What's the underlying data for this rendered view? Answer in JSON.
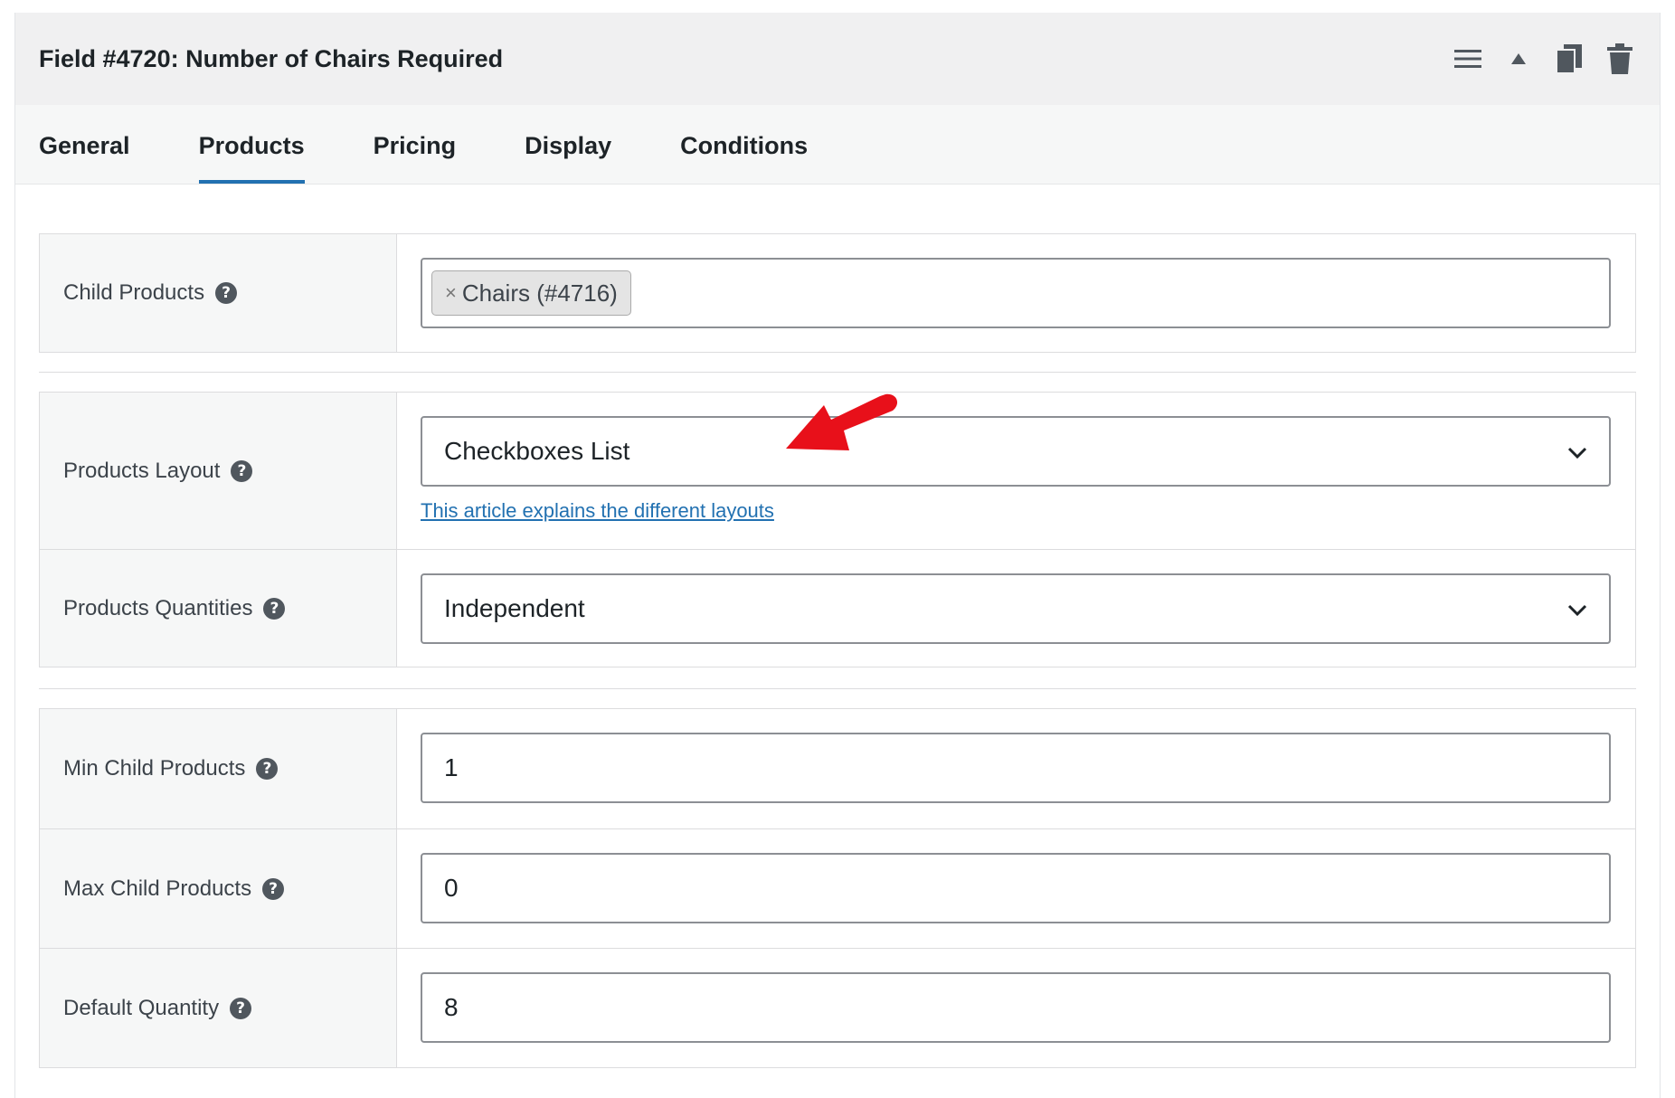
{
  "header": {
    "title": "Field #4720: Number of Chairs Required",
    "icons": [
      "menu-icon",
      "collapse-arrow-icon",
      "duplicate-icon",
      "trash-icon"
    ]
  },
  "tabs": [
    {
      "label": "General"
    },
    {
      "label": "Products",
      "active": true
    },
    {
      "label": "Pricing"
    },
    {
      "label": "Display"
    },
    {
      "label": "Conditions"
    }
  ],
  "fields": {
    "child_products": {
      "label": "Child Products",
      "tag": "Chairs (#4716)",
      "remove_symbol": "×"
    },
    "products_layout": {
      "label": "Products Layout",
      "value": "Checkboxes List",
      "link_text": "This article explains the different layouts"
    },
    "products_quantities": {
      "label": "Products Quantities",
      "value": "Independent"
    },
    "min_child_products": {
      "label": "Min Child Products",
      "value": "1"
    },
    "max_child_products": {
      "label": "Max Child Products",
      "value": "0"
    },
    "default_quantity": {
      "label": "Default Quantity",
      "value": "8"
    }
  },
  "help_symbol": "?",
  "colors": {
    "accent": "#2271b1",
    "annotation_arrow": "#e8101a",
    "header_bg": "#f0f0f1"
  }
}
